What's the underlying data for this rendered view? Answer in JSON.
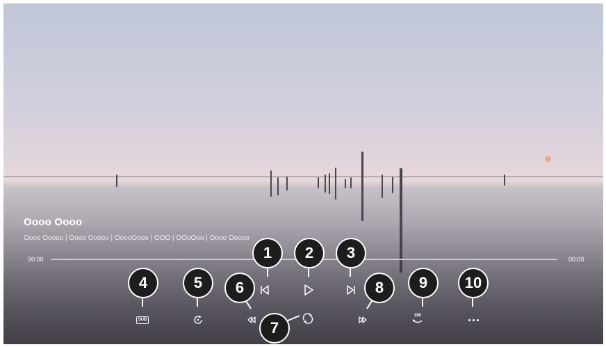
{
  "media": {
    "title": "Oooo Oooo",
    "details": "Oooo Ooooo | Oooo Ooooo | OoooOooo | OOO | OOoOoo | Oooo Ooooo"
  },
  "progress": {
    "elapsed": "00:00",
    "duration": "00:00"
  },
  "controls": {
    "subtitle_label": "SUB",
    "vr_label": "360"
  },
  "callouts": [
    "1",
    "2",
    "3",
    "4",
    "5",
    "6",
    "7",
    "8",
    "9",
    "10"
  ],
  "colors": {
    "callout_fill": "#1d1d1d",
    "callout_border": "#ffffff",
    "control_icon": "#ffffff"
  }
}
